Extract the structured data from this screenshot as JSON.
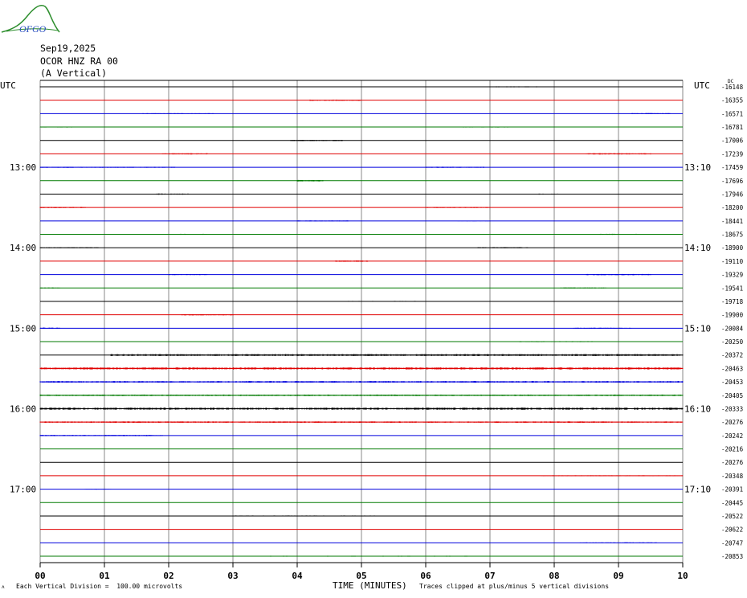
{
  "header": {
    "logo_text": "OFGO",
    "date": "Sep19,2025",
    "station": "OCOR HNZ RA 00",
    "component": "(A Vertical)"
  },
  "footer": {
    "division_note": "Each Vertical Division =  100.00 microvolts",
    "xlabel": "TIME (MINUTES)",
    "clip_note": "Traces clipped at plus/minus 5 vertical divisions"
  },
  "colors": {
    "black": "#000000",
    "red": "#e00000",
    "blue": "#0000dd",
    "green": "#007a00",
    "grid": "#888888"
  },
  "chart_data": {
    "type": "line",
    "title": "",
    "xlabel": "TIME (MINUTES)",
    "ylabel": "",
    "xlim": [
      0,
      10
    ],
    "x_ticks": [
      "00",
      "01",
      "02",
      "03",
      "04",
      "05",
      "06",
      "07",
      "08",
      "09",
      "10"
    ],
    "left_axis_title": "UTC",
    "right_axis_title": "UTC",
    "dc_label": "DC",
    "left_time_labels": [
      {
        "row": 6,
        "text": "13:00"
      },
      {
        "row": 12,
        "text": "14:00"
      },
      {
        "row": 18,
        "text": "15:00"
      },
      {
        "row": 24,
        "text": "16:00"
      },
      {
        "row": 30,
        "text": "17:00"
      }
    ],
    "right_time_labels": [
      {
        "row": 6,
        "text": "13:10"
      },
      {
        "row": 12,
        "text": "14:10"
      },
      {
        "row": 18,
        "text": "15:10"
      },
      {
        "row": 24,
        "text": "16:10"
      },
      {
        "row": 30,
        "text": "17:10"
      }
    ],
    "trace_color_cycle": [
      "black",
      "red",
      "blue",
      "green"
    ],
    "dc_offsets": [
      -16148,
      -16355,
      -16571,
      -16781,
      -17006,
      -17239,
      -17459,
      -17696,
      -17946,
      -18200,
      -18441,
      -18675,
      -18900,
      -19110,
      -19329,
      -19541,
      -19718,
      -19900,
      -20084,
      -20250,
      -20372,
      -20463,
      -20453,
      -20405,
      -20333,
      -20276,
      -20242,
      -20216,
      -20276,
      -20348,
      -20391,
      -20445,
      -20522,
      -20622,
      -20747,
      -20853
    ],
    "bursts": [
      {
        "row": 0,
        "from": 0.0,
        "to": 0.9,
        "level": 0.35
      },
      {
        "row": 0,
        "from": 7.0,
        "to": 7.9,
        "level": 0.5
      },
      {
        "row": 1,
        "from": 4.2,
        "to": 5.0,
        "level": 0.6
      },
      {
        "row": 2,
        "from": 1.6,
        "to": 2.7,
        "level": 0.4
      },
      {
        "row": 2,
        "from": 9.2,
        "to": 9.8,
        "level": 0.5
      },
      {
        "row": 3,
        "from": 0.0,
        "to": 0.5,
        "level": 0.5
      },
      {
        "row": 3,
        "from": 6.5,
        "to": 7.3,
        "level": 0.45
      },
      {
        "row": 4,
        "from": 3.9,
        "to": 4.7,
        "level": 0.6
      },
      {
        "row": 5,
        "from": 1.9,
        "to": 2.6,
        "level": 0.6
      },
      {
        "row": 5,
        "from": 8.5,
        "to": 9.5,
        "level": 0.6
      },
      {
        "row": 6,
        "from": 0.0,
        "to": 2.1,
        "level": 0.5
      },
      {
        "row": 6,
        "from": 6.0,
        "to": 6.9,
        "level": 0.55
      },
      {
        "row": 7,
        "from": 4.0,
        "to": 4.4,
        "level": 0.7
      },
      {
        "row": 8,
        "from": 1.8,
        "to": 2.3,
        "level": 0.6
      },
      {
        "row": 8,
        "from": 7.7,
        "to": 8.1,
        "level": 0.5
      },
      {
        "row": 9,
        "from": 0.0,
        "to": 0.7,
        "level": 0.6
      },
      {
        "row": 9,
        "from": 6.0,
        "to": 7.0,
        "level": 0.5
      },
      {
        "row": 10,
        "from": 4.0,
        "to": 4.8,
        "level": 0.5
      },
      {
        "row": 10,
        "from": 6.5,
        "to": 7.0,
        "level": 0.3
      },
      {
        "row": 11,
        "from": 2.1,
        "to": 2.6,
        "level": 0.5
      },
      {
        "row": 11,
        "from": 8.7,
        "to": 9.3,
        "level": 0.5
      },
      {
        "row": 12,
        "from": 0.0,
        "to": 0.9,
        "level": 0.45
      },
      {
        "row": 12,
        "from": 6.8,
        "to": 7.6,
        "level": 0.5
      },
      {
        "row": 13,
        "from": 4.6,
        "to": 5.1,
        "level": 0.7
      },
      {
        "row": 14,
        "from": 2.0,
        "to": 2.6,
        "level": 0.5
      },
      {
        "row": 14,
        "from": 8.5,
        "to": 9.5,
        "level": 0.6
      },
      {
        "row": 15,
        "from": 0.0,
        "to": 0.3,
        "level": 0.5
      },
      {
        "row": 15,
        "from": 8.1,
        "to": 8.8,
        "level": 0.5
      },
      {
        "row": 16,
        "from": 4.8,
        "to": 6.2,
        "level": 0.45
      },
      {
        "row": 17,
        "from": 2.2,
        "to": 3.0,
        "level": 0.6
      },
      {
        "row": 18,
        "from": 0.0,
        "to": 0.3,
        "level": 0.6
      },
      {
        "row": 18,
        "from": 8.3,
        "to": 9.2,
        "level": 0.5
      },
      {
        "row": 19,
        "from": 5.1,
        "to": 5.3,
        "level": 0.4
      },
      {
        "row": 19,
        "from": 7.4,
        "to": 8.6,
        "level": 0.5
      },
      {
        "row": 20,
        "from": 1.1,
        "to": 10.0,
        "level": 0.9
      },
      {
        "row": 21,
        "from": 0.0,
        "to": 10.0,
        "level": 1.0
      },
      {
        "row": 22,
        "from": 0.0,
        "to": 10.0,
        "level": 0.8
      },
      {
        "row": 23,
        "from": 0.0,
        "to": 10.0,
        "level": 0.7
      },
      {
        "row": 24,
        "from": 0.0,
        "to": 10.0,
        "level": 1.0
      },
      {
        "row": 25,
        "from": 0.0,
        "to": 10.0,
        "level": 0.7
      },
      {
        "row": 26,
        "from": 0.0,
        "to": 1.9,
        "level": 0.6
      },
      {
        "row": 29,
        "from": 7.8,
        "to": 10.0,
        "level": 0.4
      },
      {
        "row": 30,
        "from": 0.7,
        "to": 1.1,
        "level": 0.4
      },
      {
        "row": 32,
        "from": 3.0,
        "to": 5.2,
        "level": 0.45
      },
      {
        "row": 34,
        "from": 8.4,
        "to": 9.6,
        "level": 0.45
      },
      {
        "row": 35,
        "from": 3.5,
        "to": 7.0,
        "level": 0.45
      }
    ]
  }
}
